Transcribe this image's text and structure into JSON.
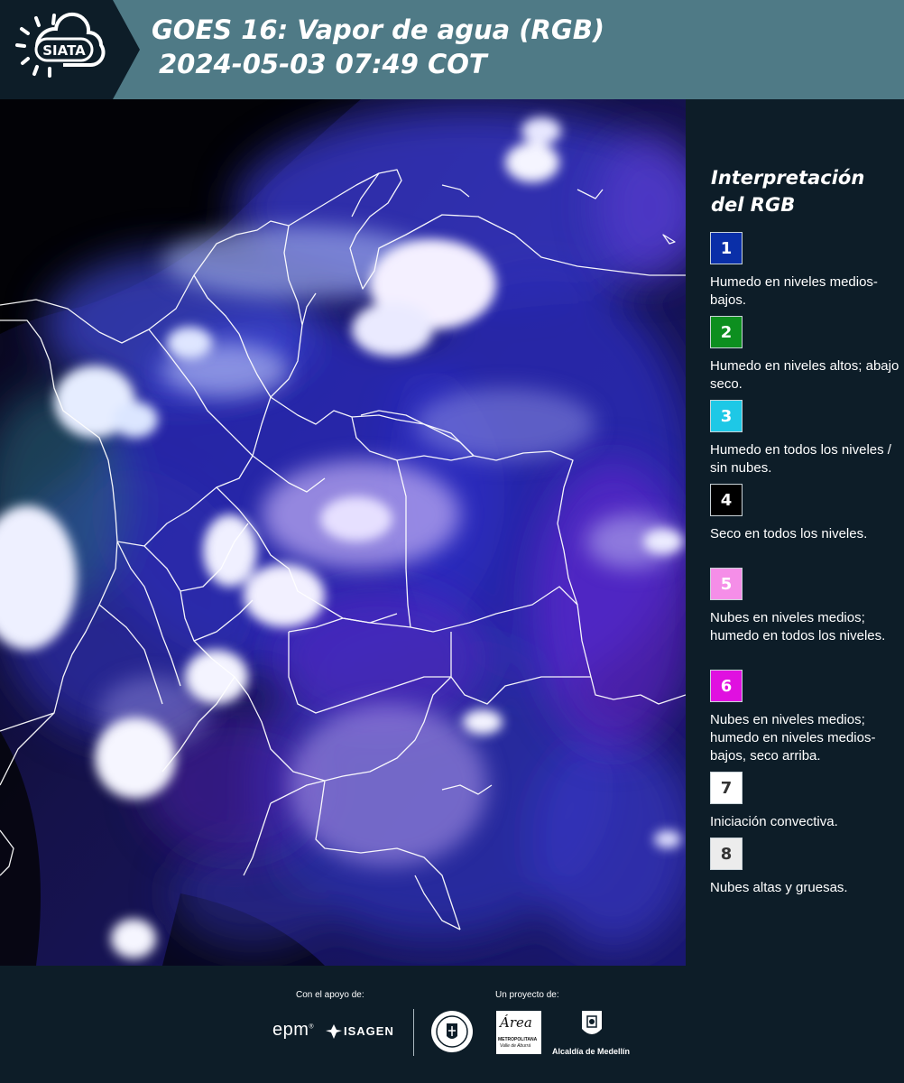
{
  "header": {
    "logo_text": "SIATA",
    "title_line1": "GOES 16: Vapor de agua (RGB)",
    "title_line2": "2024-05-03 07:49 COT"
  },
  "legend": {
    "title": "Interpretación del RGB",
    "items": [
      {
        "number": "1",
        "color": "#0a2fa8",
        "number_color": "#ffffff",
        "text": "Humedo en niveles medios-bajos."
      },
      {
        "number": "2",
        "color": "#0d8f1f",
        "number_color": "#ffffff",
        "text": "Humedo en niveles altos; abajo seco."
      },
      {
        "number": "3",
        "color": "#1ec8e6",
        "number_color": "#ffffff",
        "text": "Humedo en todos los niveles / sin nubes."
      },
      {
        "number": "4",
        "color": "#000000",
        "number_color": "#ffffff",
        "text": "Seco en todos los niveles."
      },
      {
        "number": "5",
        "color": "#f58ee8",
        "number_color": "#ffffff",
        "text": "Nubes en niveles medios; humedo en todos los niveles."
      },
      {
        "number": "6",
        "color": "#e010e0",
        "number_color": "#ffffff",
        "text": "Nubes en niveles medios; humedo en niveles medios-bajos, seco arriba."
      },
      {
        "number": "7",
        "color": "#ffffff",
        "number_color": "#333333",
        "text": "Iniciación convectiva."
      },
      {
        "number": "8",
        "color": "#ececec",
        "number_color": "#333333",
        "text": "Nubes altas y gruesas."
      }
    ]
  },
  "footer": {
    "support_label": "Con el apoyo de:",
    "project_label": "Un proyecto de:",
    "epm_text": "epm",
    "isagen_text": "ISAGEN",
    "metropolitana_title": "Área",
    "metropolitana_sub": "METROPOLITANA",
    "metropolitana_sub2": "Valle de Aburrá",
    "medellin_text": "Alcaldía de Medellín"
  }
}
